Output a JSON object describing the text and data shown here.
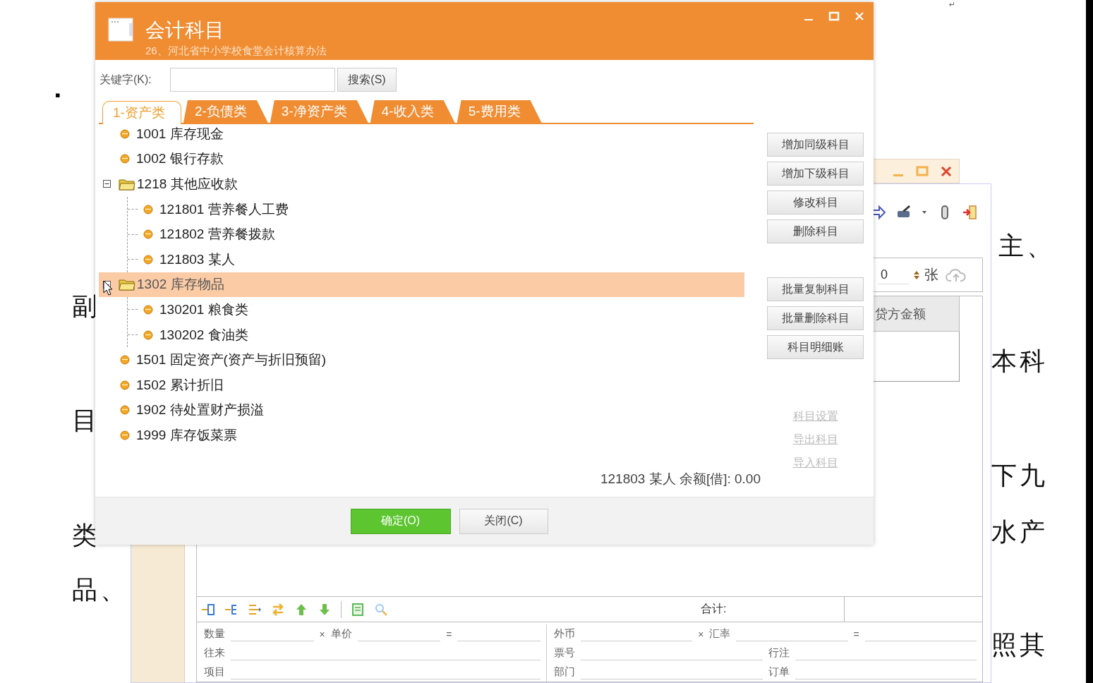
{
  "document": {
    "bullet": "▪",
    "paragraph_mark": "↵",
    "left_fragments": [
      "副",
      "目",
      "类",
      "品、"
    ],
    "right_fragments": [
      "主、",
      "本科",
      "下九",
      "水产",
      "照其"
    ]
  },
  "background_window": {
    "count_field": {
      "value": "0",
      "unit": "张"
    },
    "table": {
      "columns": [
        "贷方金额"
      ]
    },
    "entry_toolbar": {
      "total_label": "合计:"
    },
    "entry_form": {
      "rows": [
        {
          "left": [
            {
              "kind": "label",
              "text": "数量"
            },
            {
              "kind": "line"
            },
            {
              "kind": "op",
              "text": "×"
            },
            {
              "kind": "label",
              "text": "单价"
            },
            {
              "kind": "line"
            },
            {
              "kind": "op",
              "text": "="
            },
            {
              "kind": "line"
            }
          ],
          "right": [
            {
              "kind": "label",
              "text": "外币"
            },
            {
              "kind": "line"
            },
            {
              "kind": "op",
              "text": "×"
            },
            {
              "kind": "label",
              "text": "汇率"
            },
            {
              "kind": "line"
            },
            {
              "kind": "op",
              "text": "="
            },
            {
              "kind": "line"
            }
          ]
        },
        {
          "left": [
            {
              "kind": "label",
              "text": "往来"
            },
            {
              "kind": "line"
            }
          ],
          "right": [
            {
              "kind": "label",
              "text": "票号"
            },
            {
              "kind": "line"
            },
            {
              "kind": "label",
              "text": "行注"
            },
            {
              "kind": "line"
            }
          ]
        },
        {
          "left": [
            {
              "kind": "label",
              "text": "项目"
            },
            {
              "kind": "line"
            }
          ],
          "right": [
            {
              "kind": "label",
              "text": "部门"
            },
            {
              "kind": "line"
            },
            {
              "kind": "label",
              "text": "订单"
            },
            {
              "kind": "line"
            }
          ]
        }
      ]
    }
  },
  "dialog": {
    "title": "会计科目",
    "subtitle": "26、河北省中小学校食堂会计核算办法",
    "keyword_label": "关键字(K):",
    "search_button": "搜索(S)",
    "tabs": [
      {
        "label": "1-资产类",
        "selected": true
      },
      {
        "label": "2-负债类",
        "selected": false
      },
      {
        "label": "3-净资产类",
        "selected": false
      },
      {
        "label": "4-收入类",
        "selected": false
      },
      {
        "label": "5-费用类",
        "selected": false
      }
    ],
    "tree": [
      {
        "label": "1001 库存现金",
        "kind": "leaf",
        "selected": false
      },
      {
        "label": "1002 银行存款",
        "kind": "leaf",
        "selected": false
      },
      {
        "label": "1218 其他应收款",
        "kind": "folder",
        "expanded": true,
        "selected": false,
        "children": [
          {
            "label": "121801 营养餐人工费",
            "kind": "leaf",
            "selected": false
          },
          {
            "label": "121802 营养餐拨款",
            "kind": "leaf",
            "selected": false
          },
          {
            "label": "121803 某人",
            "kind": "leaf",
            "selected": false
          }
        ]
      },
      {
        "label": "1302 库存物品",
        "kind": "folder",
        "expanded": true,
        "selected": true,
        "children": [
          {
            "label": "130201 粮食类",
            "kind": "leaf",
            "selected": false
          },
          {
            "label": "130202 食油类",
            "kind": "leaf",
            "selected": false
          }
        ]
      },
      {
        "label": "1501 固定资产(资产与折旧预留)",
        "kind": "leaf",
        "selected": false
      },
      {
        "label": "1502 累计折旧",
        "kind": "leaf",
        "selected": false
      },
      {
        "label": "1902 待处置财产损溢",
        "kind": "leaf",
        "selected": false
      },
      {
        "label": "1999 库存饭菜票",
        "kind": "leaf",
        "selected": false
      }
    ],
    "button_groups": [
      [
        "增加同级科目",
        "增加下级科目",
        "修改科目",
        "删除科目"
      ],
      [
        "批量复制科目",
        "批量删除科目",
        "科目明细账"
      ]
    ],
    "links": [
      "科目设置",
      "导出科目",
      "导入科目"
    ],
    "status": "121803 某人 余额[借]: 0.00",
    "buttons": [
      {
        "label": "确定(O)",
        "kind": "primary"
      },
      {
        "label": "关闭(C)",
        "kind": "normal"
      }
    ]
  }
}
